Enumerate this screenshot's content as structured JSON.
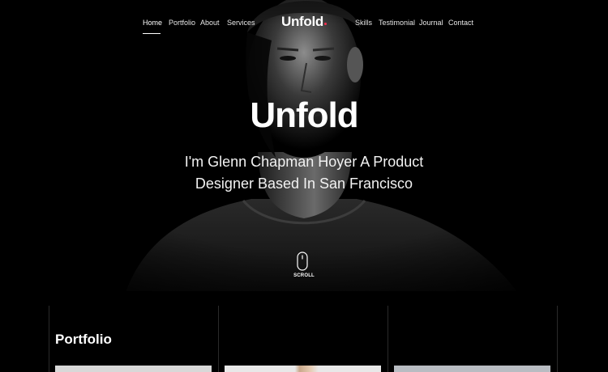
{
  "nav": {
    "left": [
      {
        "label": "Home",
        "active": true
      },
      {
        "label": "Portfolio",
        "active": false
      },
      {
        "label": "About",
        "active": false
      },
      {
        "label": "Services",
        "active": false
      }
    ],
    "brand": "Unfold",
    "right": [
      {
        "label": "Skills"
      },
      {
        "label": "Testimonial"
      },
      {
        "label": "Journal"
      },
      {
        "label": "Contact"
      }
    ]
  },
  "hero": {
    "title": "Unfold",
    "subtitle_line1": "I'm Glenn Chapman Hoyer A Product",
    "subtitle_line2": "Designer Based In San Francisco",
    "scroll_label": "SCROLL"
  },
  "portfolio": {
    "title": "Portfolio"
  },
  "colors": {
    "background": "#000000",
    "text": "#ffffff",
    "brand_accent": "#ff2e4f"
  },
  "icons": {
    "scroll": "mouse-scroll-icon"
  }
}
